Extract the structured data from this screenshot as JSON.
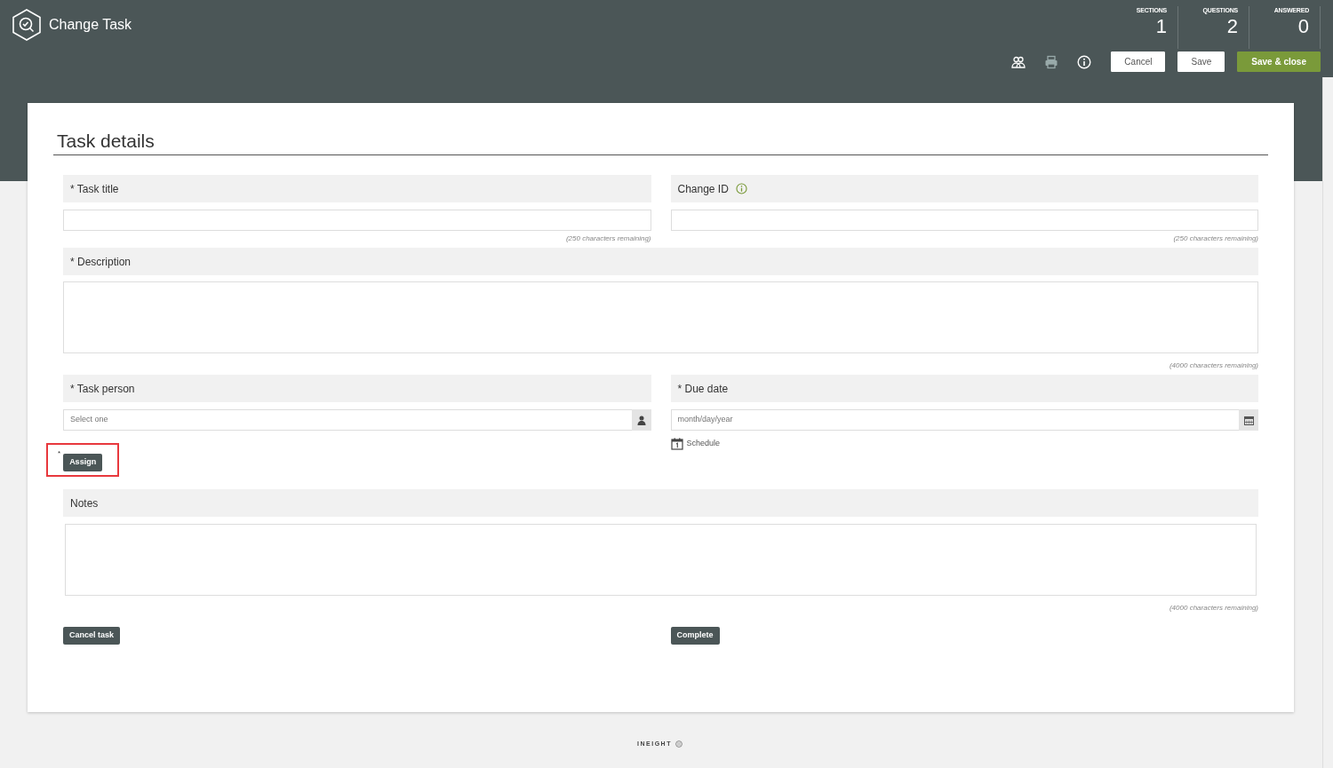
{
  "header": {
    "title": "Change Task",
    "stats": [
      {
        "label": "SECTIONS",
        "value": "1"
      },
      {
        "label": "QUESTIONS",
        "value": "2"
      },
      {
        "label": "ANSWERED",
        "value": "0"
      }
    ],
    "buttons": [
      {
        "label": "Cancel",
        "kind": "plain"
      },
      {
        "label": "Save",
        "kind": "plain"
      },
      {
        "label": "Save & close",
        "kind": "primary"
      }
    ]
  },
  "card": {
    "title": "Task details",
    "fields": [
      {
        "kind": "text",
        "label": "* Task title",
        "info": false,
        "counter": "(250 characters remaining)"
      },
      {
        "kind": "text",
        "label": "Change ID",
        "info": true,
        "counter": "(250 characters remaining)"
      },
      {
        "kind": "textarea",
        "label": "* Description",
        "info": false,
        "counter": "(4000 characters remaining)"
      },
      {
        "kind": "person",
        "label": "* Task person",
        "info": false,
        "placeholder": "Select one"
      },
      {
        "kind": "date",
        "label": "* Due date",
        "info": false,
        "placeholder": "month/day/year",
        "link": "Schedule"
      }
    ],
    "assign": {
      "marker": "*",
      "label": "Assign",
      "highlighted": true
    },
    "notes": {
      "label": "Notes",
      "counter": "(4000 characters remaining)"
    },
    "actions": [
      "Cancel task",
      "Complete"
    ]
  },
  "footer": {
    "logo": "INEIGHT"
  }
}
